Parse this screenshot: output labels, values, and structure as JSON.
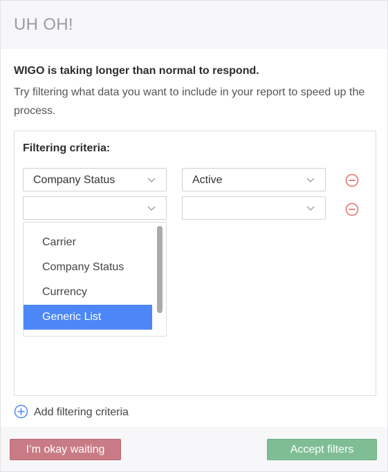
{
  "header": {
    "title": "UH OH!"
  },
  "message": {
    "bold": "WIGO is taking longer than normal to respond.",
    "text": "Try filtering what data you want to include in your report to speed up the process."
  },
  "criteria": {
    "title": "Filtering criteria:",
    "rows": [
      {
        "field": "Company Status",
        "value": "Active"
      },
      {
        "field": "",
        "value": ""
      }
    ],
    "dropdown": {
      "options": [
        "Carrier",
        "Company Status",
        "Currency",
        "Generic List"
      ],
      "highlighted": "Generic List"
    },
    "add_label": "Add filtering criteria"
  },
  "footer": {
    "wait_label": "I’m okay waiting",
    "accept_label": "Accept filters"
  },
  "colors": {
    "remove_icon": "#e57373",
    "add_icon": "#4d87f7",
    "highlight": "#4d87f7",
    "wait_button": "#c97b85",
    "accept_button": "#7fbe95"
  },
  "icons": {
    "chevron": "chevron-down-icon",
    "remove": "minus-circle-icon",
    "add": "plus-circle-icon"
  }
}
